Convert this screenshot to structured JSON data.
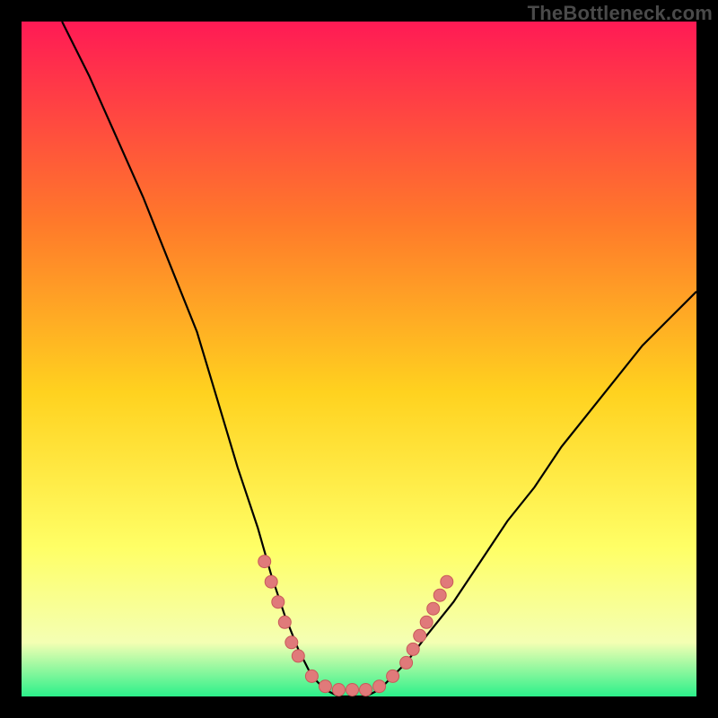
{
  "watermark": "TheBottleneck.com",
  "colors": {
    "bg": "#000000",
    "grad_top": "#ff1a55",
    "grad_mid1": "#ff7a2a",
    "grad_mid2": "#ffd21f",
    "grad_mid3": "#ffff66",
    "grad_mid4": "#f4ffb3",
    "grad_bottom": "#2cf08a",
    "curve": "#000000",
    "marker_fill": "#e07a7a",
    "marker_stroke": "#c95a5a"
  },
  "chart_data": {
    "type": "line",
    "title": "",
    "xlabel": "",
    "ylabel": "",
    "xlim": [
      0,
      100
    ],
    "ylim": [
      0,
      100
    ],
    "grid": false,
    "legend": false,
    "curve": [
      {
        "x": 6,
        "y": 100
      },
      {
        "x": 10,
        "y": 92
      },
      {
        "x": 14,
        "y": 83
      },
      {
        "x": 18,
        "y": 74
      },
      {
        "x": 22,
        "y": 64
      },
      {
        "x": 26,
        "y": 54
      },
      {
        "x": 29,
        "y": 44
      },
      {
        "x": 32,
        "y": 34
      },
      {
        "x": 35,
        "y": 25
      },
      {
        "x": 37,
        "y": 18
      },
      {
        "x": 39,
        "y": 12
      },
      {
        "x": 41,
        "y": 7
      },
      {
        "x": 43,
        "y": 3
      },
      {
        "x": 45,
        "y": 1
      },
      {
        "x": 47,
        "y": 0
      },
      {
        "x": 49,
        "y": 0
      },
      {
        "x": 51,
        "y": 0
      },
      {
        "x": 53,
        "y": 1
      },
      {
        "x": 55,
        "y": 3
      },
      {
        "x": 57,
        "y": 5
      },
      {
        "x": 60,
        "y": 9
      },
      {
        "x": 64,
        "y": 14
      },
      {
        "x": 68,
        "y": 20
      },
      {
        "x": 72,
        "y": 26
      },
      {
        "x": 76,
        "y": 31
      },
      {
        "x": 80,
        "y": 37
      },
      {
        "x": 84,
        "y": 42
      },
      {
        "x": 88,
        "y": 47
      },
      {
        "x": 92,
        "y": 52
      },
      {
        "x": 96,
        "y": 56
      },
      {
        "x": 100,
        "y": 60
      }
    ],
    "markers": [
      {
        "x": 36,
        "y": 20
      },
      {
        "x": 37,
        "y": 17
      },
      {
        "x": 38,
        "y": 14
      },
      {
        "x": 39,
        "y": 11
      },
      {
        "x": 40,
        "y": 8
      },
      {
        "x": 41,
        "y": 6
      },
      {
        "x": 43,
        "y": 3
      },
      {
        "x": 45,
        "y": 1.5
      },
      {
        "x": 47,
        "y": 1
      },
      {
        "x": 49,
        "y": 1
      },
      {
        "x": 51,
        "y": 1
      },
      {
        "x": 53,
        "y": 1.5
      },
      {
        "x": 55,
        "y": 3
      },
      {
        "x": 57,
        "y": 5
      },
      {
        "x": 58,
        "y": 7
      },
      {
        "x": 59,
        "y": 9
      },
      {
        "x": 60,
        "y": 11
      },
      {
        "x": 61,
        "y": 13
      },
      {
        "x": 62,
        "y": 15
      },
      {
        "x": 63,
        "y": 17
      }
    ]
  }
}
